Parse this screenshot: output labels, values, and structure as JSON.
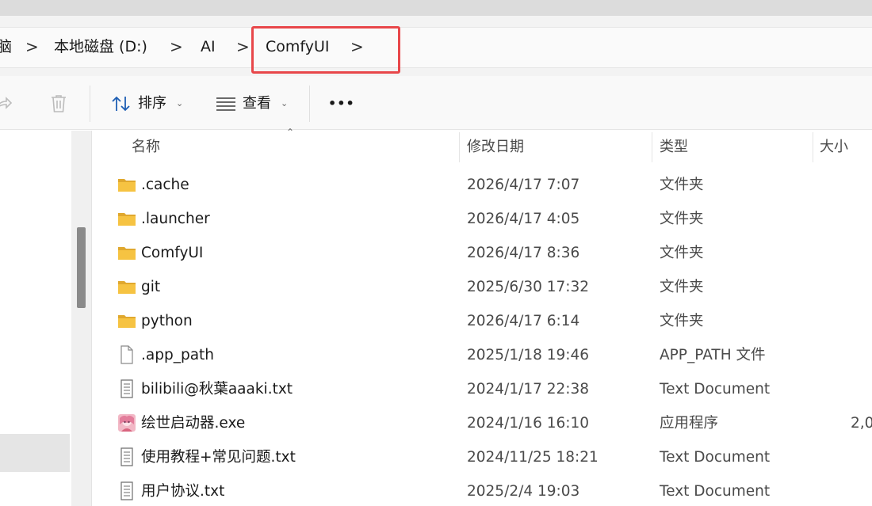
{
  "breadcrumb": {
    "items": [
      "脑",
      "本地磁盘 (D:)",
      "AI",
      "ComfyUI"
    ],
    "separator": ">"
  },
  "toolbar": {
    "sort_label": "排序",
    "view_label": "查看",
    "more_label": "•••"
  },
  "columns": {
    "name": "名称",
    "date": "修改日期",
    "type": "类型",
    "size": "大小"
  },
  "files": [
    {
      "name": ".cache",
      "date": "2026/4/17 7:07",
      "type": "文件夹",
      "size": "",
      "icon": "folder-icon"
    },
    {
      "name": ".launcher",
      "date": "2026/4/17 4:05",
      "type": "文件夹",
      "size": "",
      "icon": "folder-icon"
    },
    {
      "name": "ComfyUI",
      "date": "2026/4/17 8:36",
      "type": "文件夹",
      "size": "",
      "icon": "folder-icon"
    },
    {
      "name": "git",
      "date": "2025/6/30 17:32",
      "type": "文件夹",
      "size": "",
      "icon": "folder-icon"
    },
    {
      "name": "python",
      "date": "2026/4/17 6:14",
      "type": "文件夹",
      "size": "",
      "icon": "folder-icon"
    },
    {
      "name": ".app_path",
      "date": "2025/1/18 19:46",
      "type": "APP_PATH 文件",
      "size": "",
      "icon": "blank-file-icon"
    },
    {
      "name": "bilibili@秋葉aaaki.txt",
      "date": "2024/1/17 22:38",
      "type": "Text Document",
      "size": "",
      "icon": "text-file-icon"
    },
    {
      "name": "绘世启动器.exe",
      "date": "2024/1/16 16:10",
      "type": "应用程序",
      "size": "2,0",
      "icon": "app-icon"
    },
    {
      "name": "使用教程+常见问题.txt",
      "date": "2024/11/25 18:21",
      "type": "Text Document",
      "size": "",
      "icon": "text-file-icon"
    },
    {
      "name": "用户协议.txt",
      "date": "2025/2/4 19:03",
      "type": "Text Document",
      "size": "",
      "icon": "text-file-icon"
    }
  ],
  "colors": {
    "highlight": "#e8474a",
    "folder": "#f6c342",
    "folder_dark": "#e0a82e"
  }
}
